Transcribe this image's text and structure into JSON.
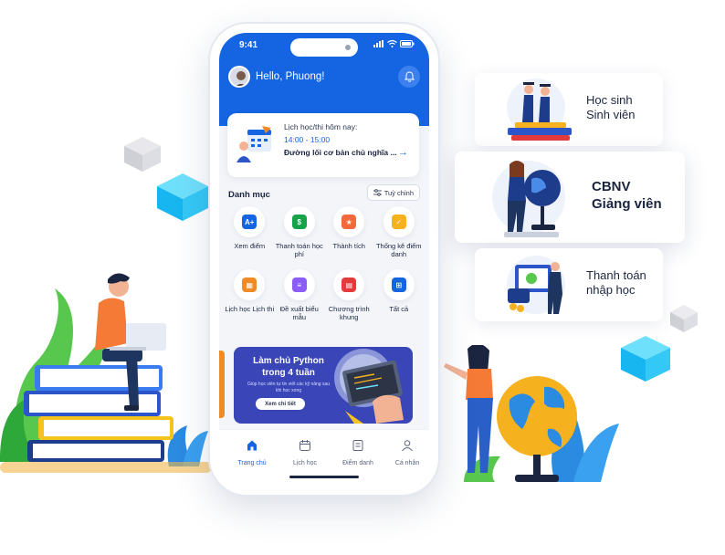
{
  "status": {
    "time": "9:41"
  },
  "header": {
    "greeting": "Hello, Phuong!"
  },
  "schedule": {
    "label": "Lịch học/thi hôm nay:",
    "time": "14:00 - 15:00",
    "subject": "Đường lối cơ bản chủ nghĩa ...",
    "arrow": "→"
  },
  "categories": {
    "title": "Danh mục",
    "customize_label": "Tuỳ chỉnh",
    "items": [
      {
        "label": "Xem điểm",
        "icon": "grade-icon",
        "color": "#1565e3",
        "glyph": "A+"
      },
      {
        "label": "Thanh toán học phí",
        "icon": "tuition-icon",
        "color": "#16a34a",
        "glyph": "$"
      },
      {
        "label": "Thành tích",
        "icon": "achievement-icon",
        "color": "#f4693c",
        "glyph": "★"
      },
      {
        "label": "Thống kê điểm danh",
        "icon": "attendance-icon",
        "color": "#f5b21e",
        "glyph": "✓"
      },
      {
        "label": "Lịch học Lịch thi",
        "icon": "calendar-icon",
        "color": "#f08a24",
        "glyph": "▦"
      },
      {
        "label": "Đề xuất biểu mẫu",
        "icon": "form-icon",
        "color": "#8b5cf6",
        "glyph": "≡"
      },
      {
        "label": "Chương trình khung",
        "icon": "book-icon",
        "color": "#e23b3b",
        "glyph": "▤"
      },
      {
        "label": "Tất cả",
        "icon": "all-apps-icon",
        "color": "#1565e3",
        "glyph": "⊞"
      }
    ]
  },
  "banner": {
    "title": "Làm chủ Python trong 4 tuần",
    "subtitle": "Giúp học viên tự tin viết các kỹ năng sau khi học xong",
    "button": "Xem chi tiết"
  },
  "tabs": [
    {
      "label": "Trang chủ",
      "icon": "home-icon",
      "active": true
    },
    {
      "label": "Lịch học",
      "icon": "calendar-icon",
      "active": false
    },
    {
      "label": "Điểm danh",
      "icon": "checklist-icon",
      "active": false
    },
    {
      "label": "Cá nhân",
      "icon": "user-icon",
      "active": false
    }
  ],
  "roles": [
    {
      "line1": "Học sinh",
      "line2": "Sinh viên"
    },
    {
      "line1": "CBNV",
      "line2": "Giảng viên"
    },
    {
      "line1": "Thanh toán",
      "line2": "nhập học"
    }
  ],
  "colors": {
    "primary": "#1565e3",
    "banner": "#3a45b8",
    "accent_orange": "#f08a24"
  }
}
